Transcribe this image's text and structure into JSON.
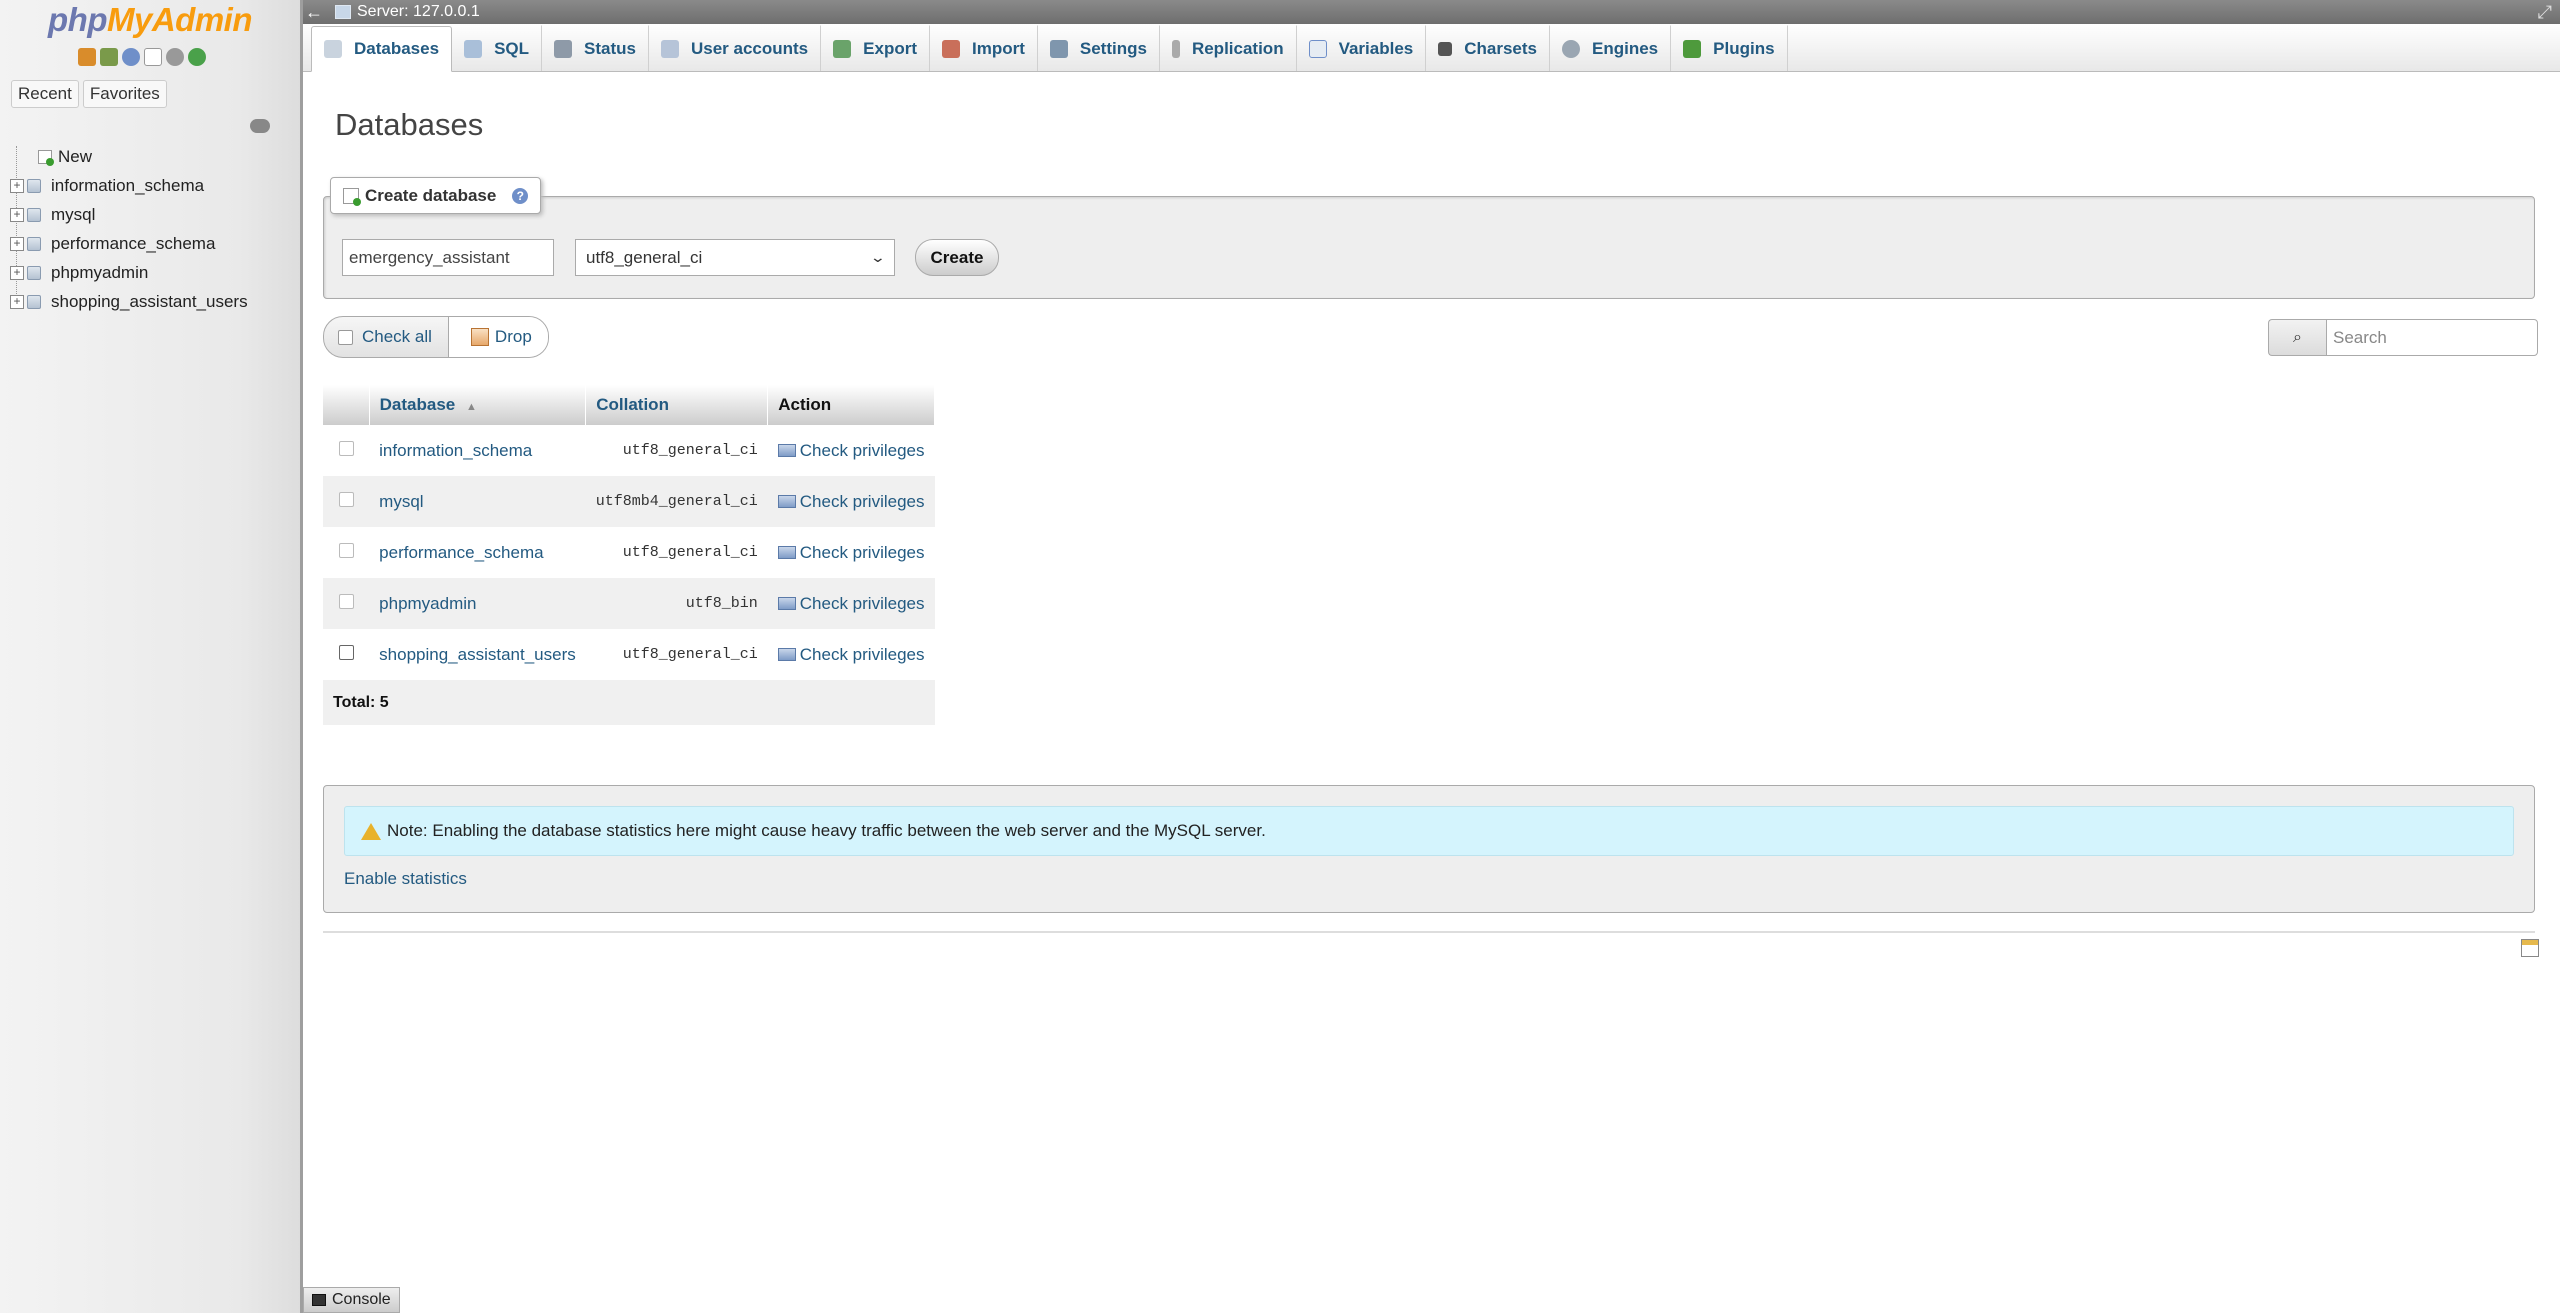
{
  "nav": {
    "logo_php": "php",
    "logo_myadmin": "MyAdmin",
    "icons": [
      "home-icon",
      "sql-query-icon",
      "help-icon",
      "documentation-icon",
      "settings-icon",
      "reload-icon"
    ],
    "tabs": [
      {
        "label": "Recent"
      },
      {
        "label": "Favorites"
      }
    ],
    "new_label": "New",
    "databases": [
      {
        "label": "information_schema"
      },
      {
        "label": "mysql"
      },
      {
        "label": "performance_schema"
      },
      {
        "label": "phpmyadmin"
      },
      {
        "label": "shopping_assistant_users"
      }
    ]
  },
  "topbar": {
    "back": "←",
    "server": "Server: 127.0.0.1"
  },
  "menu": {
    "tabs": [
      {
        "label": "Databases",
        "icon": "database-icon",
        "active": true
      },
      {
        "label": "SQL",
        "icon": "sql-icon"
      },
      {
        "label": "Status",
        "icon": "status-icon"
      },
      {
        "label": "User accounts",
        "icon": "users-icon"
      },
      {
        "label": "Export",
        "icon": "export-icon"
      },
      {
        "label": "Import",
        "icon": "import-icon"
      },
      {
        "label": "Settings",
        "icon": "settings-icon"
      },
      {
        "label": "Replication",
        "icon": "replication-icon"
      },
      {
        "label": "Variables",
        "icon": "variables-icon"
      },
      {
        "label": "Charsets",
        "icon": "charsets-icon"
      },
      {
        "label": "Engines",
        "icon": "engines-icon"
      },
      {
        "label": "Plugins",
        "icon": "plugins-icon"
      }
    ]
  },
  "main": {
    "title": "Databases",
    "create": {
      "legend": "Create database",
      "db_name_value": "emergency_assistant",
      "collation_value": "utf8_general_ci",
      "button": "Create"
    },
    "bulk": {
      "check_all": "Check all",
      "drop": "Drop"
    },
    "search": {
      "placeholder": "Search"
    },
    "table": {
      "headers": {
        "database": "Database",
        "collation": "Collation",
        "action": "Action"
      },
      "rows": [
        {
          "name": "information_schema",
          "collation": "utf8_general_ci",
          "action": "Check privileges"
        },
        {
          "name": "mysql",
          "collation": "utf8mb4_general_ci",
          "action": "Check privileges"
        },
        {
          "name": "performance_schema",
          "collation": "utf8_general_ci",
          "action": "Check privileges"
        },
        {
          "name": "phpmyadmin",
          "collation": "utf8_bin",
          "action": "Check privileges"
        },
        {
          "name": "shopping_assistant_users",
          "collation": "utf8_general_ci",
          "action": "Check privileges"
        }
      ],
      "total": "Total: 5"
    },
    "note": "Note: Enabling the database statistics here might cause heavy traffic between the web server and the MySQL server.",
    "enable_stats": "Enable statistics"
  },
  "console": {
    "label": "Console"
  },
  "colors": {
    "link": "#235a81",
    "note_bg": "#d4f4fd",
    "logo_php": "#6c78af",
    "logo_myadmin": "#f89c0e"
  }
}
